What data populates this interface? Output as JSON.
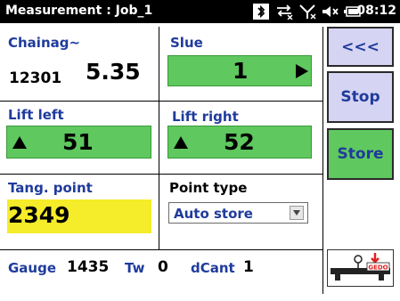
{
  "titlebar": {
    "title": "Measurement : Job_1",
    "time": "08:12"
  },
  "chainage": {
    "label": "Chainag~",
    "prefix": "12301",
    "value": "5.35"
  },
  "slue": {
    "label": "Slue",
    "value": "1"
  },
  "lift_left": {
    "label": "Lift left",
    "value": "51"
  },
  "lift_right": {
    "label": "Lift right",
    "value": "52"
  },
  "tang_point": {
    "label": "Tang. point",
    "value": "2349"
  },
  "point_type": {
    "label": "Point type",
    "selected": "Auto store"
  },
  "side_buttons": {
    "back_label": "<<<",
    "stop_label": "Stop",
    "store_label": "Store"
  },
  "footer": {
    "gauge_label": "Gauge",
    "gauge_value": "1435",
    "tw_label": "Tw",
    "tw_value": "0",
    "dcant_label": "dCant",
    "dcant_value": "1"
  },
  "gedo_logo_text": "GEDO",
  "colors": {
    "accent_blue": "#1f3b9c",
    "green": "#5fc85f",
    "yellow": "#f5ec2a",
    "button_lavender": "#d5d4f2"
  }
}
